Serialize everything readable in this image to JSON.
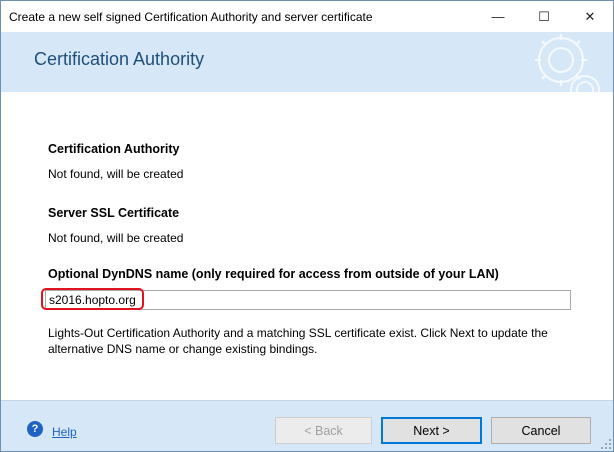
{
  "window": {
    "title": "Create a new self signed Certification Authority and server certificate",
    "min_glyph": "—",
    "max_glyph": "☐",
    "close_glyph": "✕"
  },
  "banner": {
    "title": "Certification Authority"
  },
  "sections": {
    "ca_heading": "Certification Authority",
    "ca_status": "Not found, will be created",
    "ssl_heading": "Server SSL Certificate",
    "ssl_status": "Not found, will be created",
    "dns_heading": "Optional DynDNS name (only required for access from outside of your LAN)",
    "dns_value": "s2016.hopto.org",
    "info": "Lights-Out Certification Authority and a matching SSL certificate exist. Click Next to update the alternative DNS name or change existing bindings."
  },
  "footer": {
    "help_glyph": "?",
    "help_label": "Help",
    "back_label": "< Back",
    "next_label": "Next >",
    "cancel_label": "Cancel"
  },
  "colors": {
    "banner_bg": "#d6e8f8",
    "banner_title": "#1f4e79",
    "highlight": "#e0141e",
    "link": "#1e63c4"
  }
}
